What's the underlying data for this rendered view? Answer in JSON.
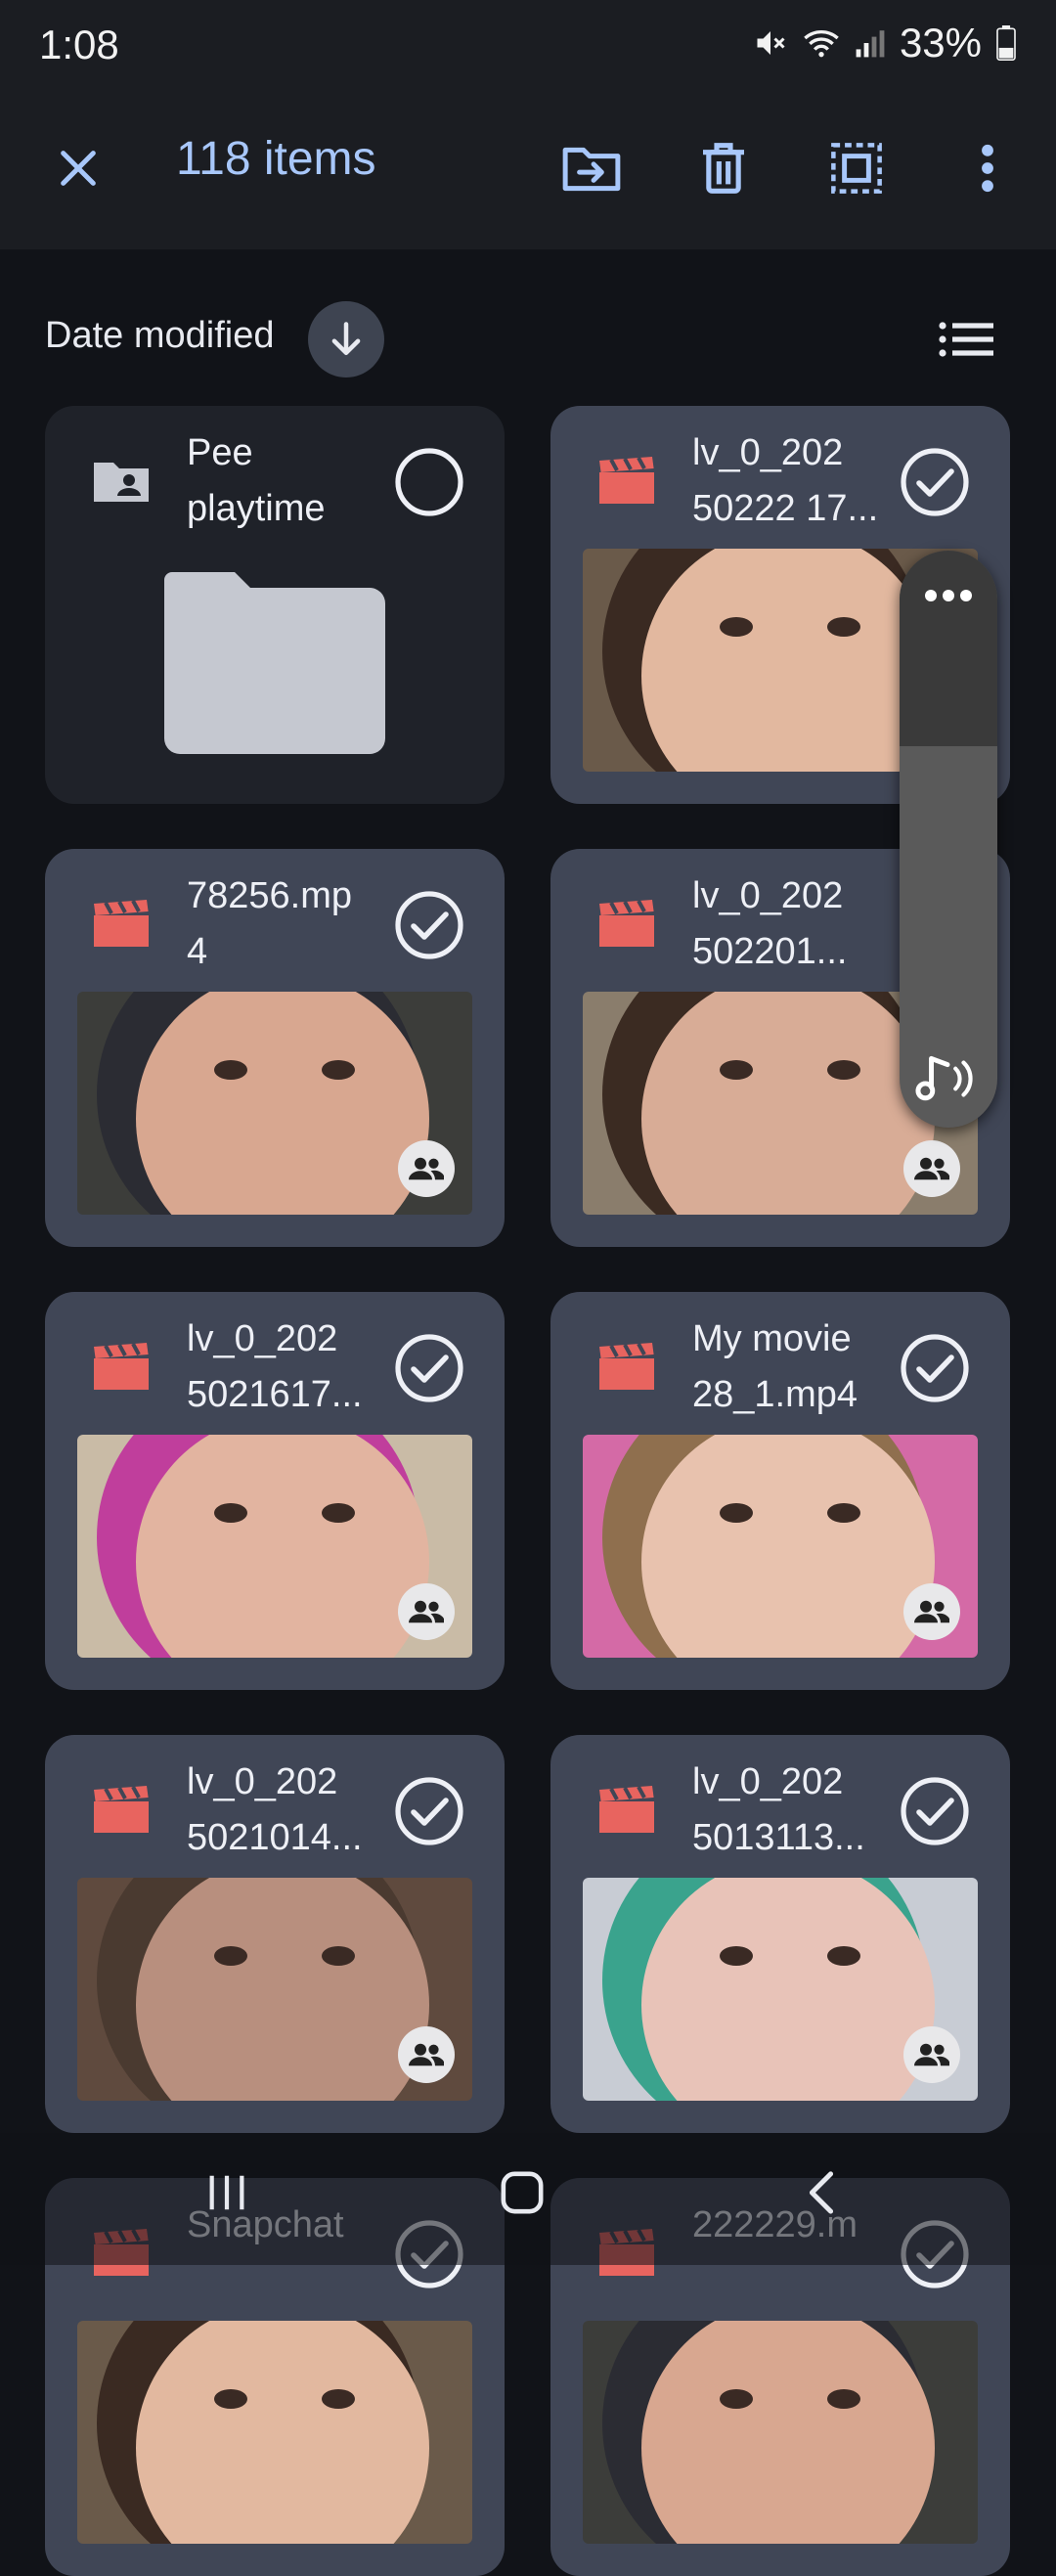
{
  "status": {
    "time": "1:08",
    "battery": "33%"
  },
  "app_bar": {
    "title": "118 items"
  },
  "sort": {
    "label": "Date modified"
  },
  "items": [
    {
      "name": "Pee\nplaytime",
      "type": "folder",
      "selected": false
    },
    {
      "name": "lv_0_202\n50222 17...",
      "type": "video",
      "selected": true,
      "shared": false
    },
    {
      "name": "78256.mp\n4",
      "type": "video",
      "selected": true,
      "shared": true
    },
    {
      "name": "lv_0_202\n502201...",
      "type": "video",
      "selected": true,
      "shared": true
    },
    {
      "name": "lv_0_202\n5021617...",
      "type": "video",
      "selected": true,
      "shared": true
    },
    {
      "name": "My movie\n28_1.mp4",
      "type": "video",
      "selected": true,
      "shared": true
    },
    {
      "name": "lv_0_202\n5021014...",
      "type": "video",
      "selected": true,
      "shared": true
    },
    {
      "name": "lv_0_202\n5013113...",
      "type": "video",
      "selected": true,
      "shared": true
    },
    {
      "name": "Snapchat",
      "type": "video",
      "selected": true
    },
    {
      "name": "222229.m",
      "type": "video",
      "selected": true
    }
  ],
  "colors": {
    "accent": "#a8c7fa",
    "video_icon": "#e8645f",
    "card_bg": "#404656"
  },
  "icons": {
    "close": "close-icon",
    "move": "move-to-folder-icon",
    "delete": "trash-icon",
    "select_all": "select-all-icon",
    "more": "more-vert-icon",
    "sort": "arrow-down-icon",
    "list": "list-view-icon",
    "video": "clapperboard-icon",
    "folder": "folder-shared-icon",
    "shared": "people-icon",
    "check": "check-circle-icon"
  }
}
